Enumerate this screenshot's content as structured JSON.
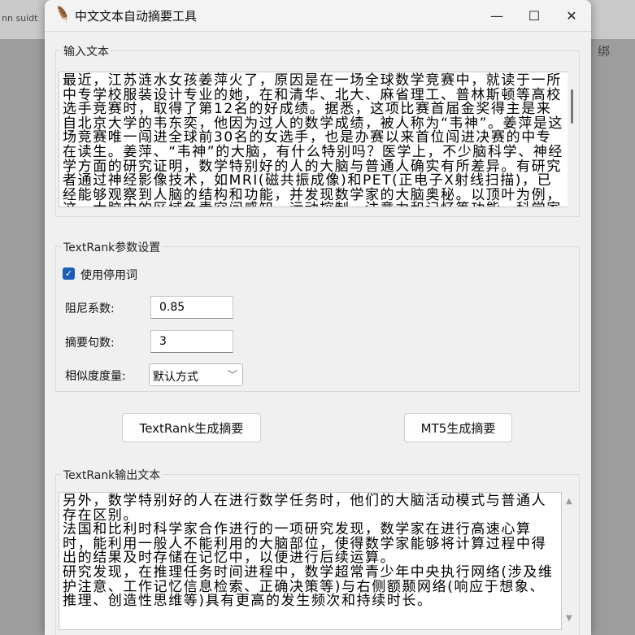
{
  "background": {
    "texts": [
      "nn suidt",
      "绑"
    ]
  },
  "window": {
    "title": "中文文本自动摘要工具",
    "icon": "feather-icon"
  },
  "input": {
    "frame_label": "输入文本",
    "text": "最近，江苏涟水女孩姜萍火了，原因是在一场全球数学竞赛中，就读于一所中专学校服装设计专业的她，在和清华、北大、麻省理工、普林斯顿等高校选手竞赛时，取得了第12名的好成绩。据悉，这项比赛首届金奖得主是来自北京大学的韦东奕，他因为过人的数学成绩，被人称为“韦神”。姜萍是这场竞赛唯一闯进全球前30名的女选手，也是办赛以来首位闯进决赛的中专在读生。姜萍、“韦神”的大脑，有什么特别吗？医学上，不少脑科学、神经学方面的研究证明，数学特别好的人的大脑与普通人确实有所差异。有研究者通过神经影像技术，如MRI(磁共振成像)和PET(正电子X射线扫描)，已经能够观察到人脑的结构和功能，并发现数学家的大脑奥秘。以顶叶为例，这一大脑中的区域负责空间感知、运动控制、注意力和记忆等功能。科学家发现，数学好的人通常拥有更大、更厚、更对称"
  },
  "params": {
    "frame_label": "TextRank参数设置",
    "use_stopwords_label": "使用停用词",
    "use_stopwords": true,
    "damping_label": "阻尼系数:",
    "damping_value": "0.85",
    "sentences_label": "摘要句数:",
    "sentences_value": "3",
    "similarity_label": "相似度度量:",
    "similarity_value": "默认方式"
  },
  "buttons": {
    "textrank": "TextRank生成摘要",
    "mt5": "MT5生成摘要"
  },
  "output": {
    "frame_label": "TextRank输出文本",
    "text": "另外，数学特别好的人在进行数学任务时，他们的大脑活动模式与普通人存在区别。\n法国和比利时科学家合作进行的一项研究发现，数学家在进行高速心算时，能利用一般人不能利用的大脑部位，使得数学家能够将计算过程中得出的结果及时存储在记忆中，以便进行后续运算。\n研究发现，在推理任务时间进程中，数学超常青少年中央执行网络(涉及维护注意、工作记忆信息检索、正确决策等)与右侧额颞网络(响应于想象、推理、创造性思维等)具有更高的发生频次和持续时长。"
  }
}
